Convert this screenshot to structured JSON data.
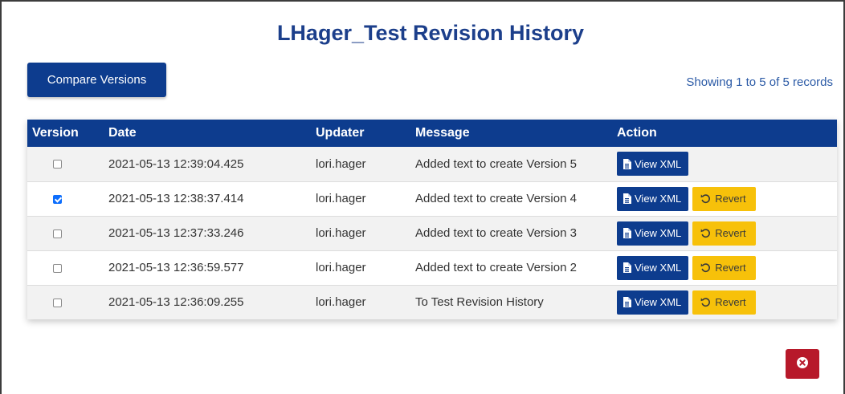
{
  "modal": {
    "title": "LHager_Test Revision History",
    "compare_label": "Compare Versions",
    "record_count": "Showing 1 to 5 of 5 records",
    "close_icon": "times-circle-icon"
  },
  "table": {
    "headers": {
      "version": "Version",
      "date": "Date",
      "updater": "Updater",
      "message": "Message",
      "action": "Action"
    },
    "view_label": "View XML",
    "revert_label": "Revert",
    "rows": [
      {
        "date": "2021-05-13 12:39:04.425",
        "updater": "lori.hager",
        "message": "Added text to create Version 5",
        "checked": false,
        "show_revert": false
      },
      {
        "date": "2021-05-13 12:38:37.414",
        "updater": "lori.hager",
        "message": "Added text to create Version 4",
        "checked": true,
        "show_revert": true
      },
      {
        "date": "2021-05-13 12:37:33.246",
        "updater": "lori.hager",
        "message": "Added text to create Version 3",
        "checked": false,
        "show_revert": true
      },
      {
        "date": "2021-05-13 12:36:59.577",
        "updater": "lori.hager",
        "message": "Added text to create Version 2",
        "checked": false,
        "show_revert": true
      },
      {
        "date": "2021-05-13 12:36:09.255",
        "updater": "lori.hager",
        "message": "To Test Revision History",
        "checked": false,
        "show_revert": true
      }
    ]
  },
  "colors": {
    "primary": "#0d3c8e",
    "title": "#1c3f8b",
    "warning": "#f7c10a",
    "danger": "#b7192a",
    "checkbox_checked": "#0d6efd"
  }
}
